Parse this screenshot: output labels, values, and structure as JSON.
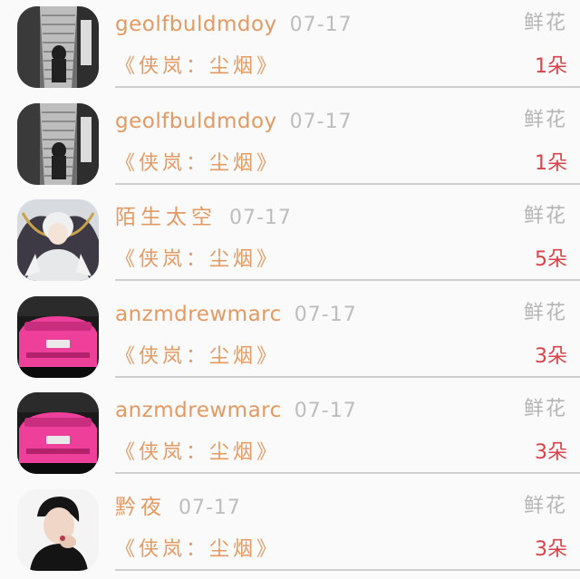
{
  "colors": {
    "name": "#e39a62",
    "date": "#bdbdbd",
    "gift_type": "#b5b5b5",
    "count": "#d9424b",
    "divider": "#cfcfcf",
    "background": "#fbfafa"
  },
  "records": [
    {
      "avatar": "grayscale-staircase-photo",
      "name": "geolfbuldmdoy",
      "date": "07-17",
      "gift_type": "鲜花",
      "event": "《侠岚：尘烟》",
      "count": "1朵"
    },
    {
      "avatar": "grayscale-staircase-photo",
      "name": "geolfbuldmdoy",
      "date": "07-17",
      "gift_type": "鲜花",
      "event": "《侠岚：尘烟》",
      "count": "1朵"
    },
    {
      "avatar": "anime-angel-illustration",
      "name": "陌生太空",
      "date": "07-17",
      "gift_type": "鲜花",
      "event": "《侠岚：尘烟》",
      "count": "5朵"
    },
    {
      "avatar": "pink-car-photo",
      "name": "anzmdrewmarc",
      "date": "07-17",
      "gift_type": "鲜花",
      "event": "《侠岚：尘烟》",
      "count": "3朵"
    },
    {
      "avatar": "pink-car-photo",
      "name": "anzmdrewmarc",
      "date": "07-17",
      "gift_type": "鲜花",
      "event": "《侠岚：尘烟》",
      "count": "3朵"
    },
    {
      "avatar": "person-portrait-photo",
      "name": "黔夜",
      "date": "07-17",
      "gift_type": "鲜花",
      "event": "《侠岚：尘烟》",
      "count": "3朵"
    }
  ]
}
